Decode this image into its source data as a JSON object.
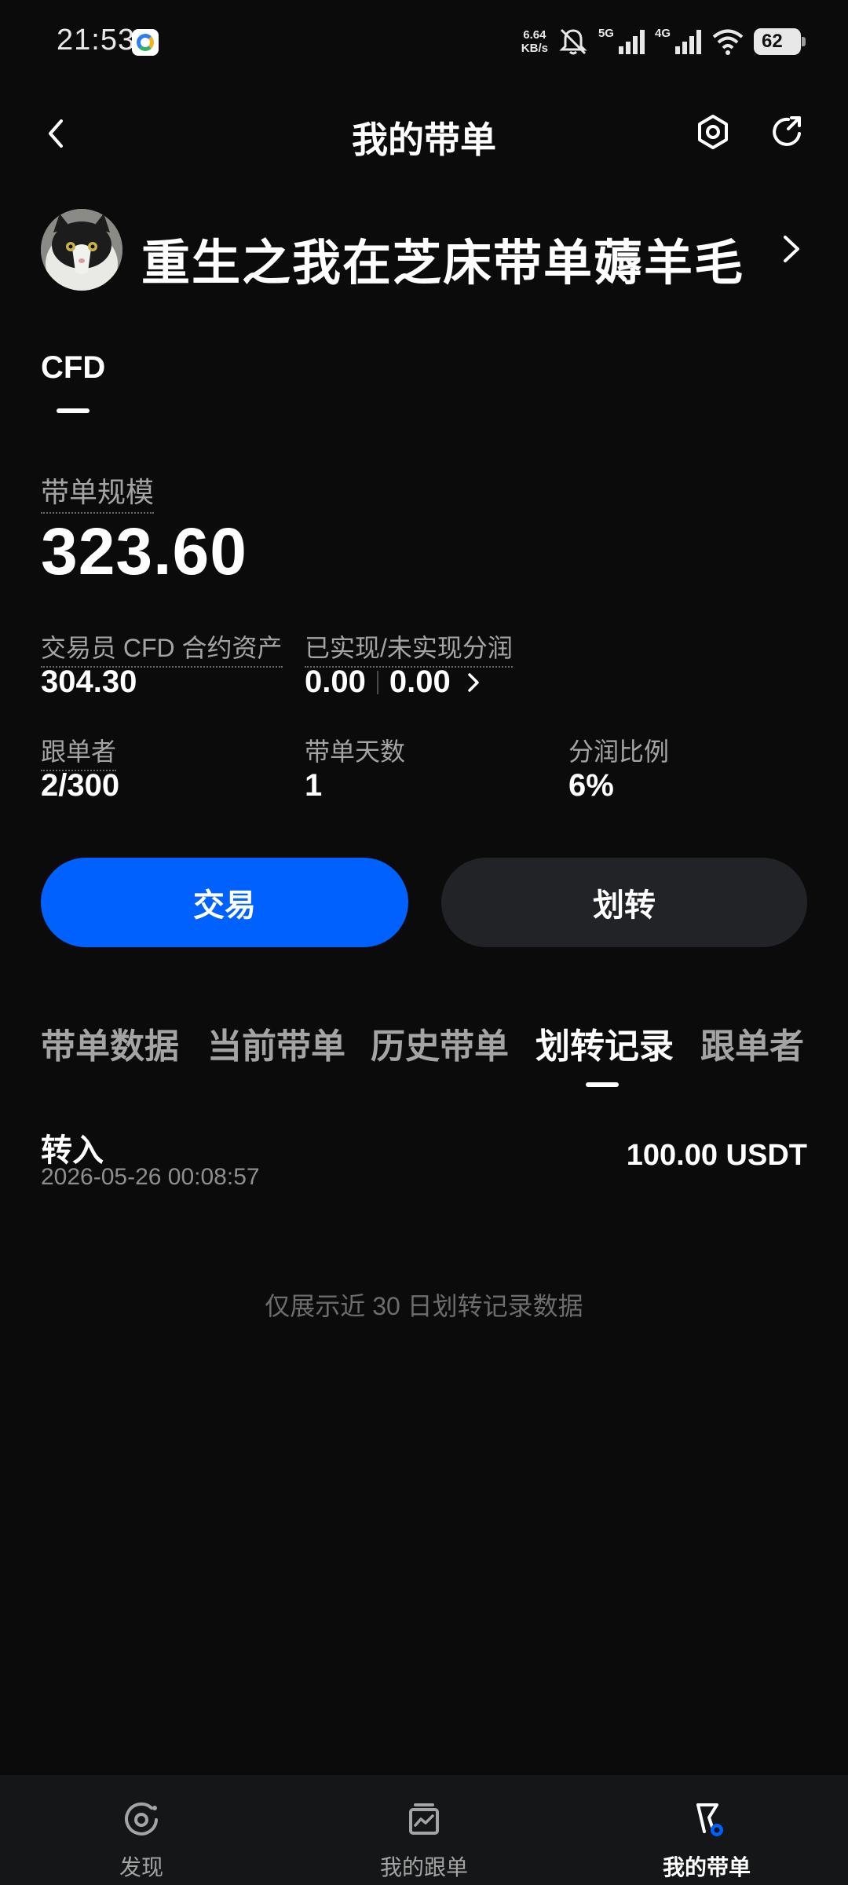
{
  "status_bar": {
    "time": "21:53",
    "net_speed_value": "6.64",
    "net_speed_unit": "KB/s",
    "sim1_label": "5G",
    "sim2_label": "4G",
    "battery_level": "62"
  },
  "header": {
    "title": "我的带单",
    "icons": [
      "back-icon",
      "settings-icon",
      "share-icon"
    ]
  },
  "profile": {
    "name": "重生之我在芝床带单薅羊毛"
  },
  "product_tab": {
    "label": "CFD"
  },
  "scale": {
    "label": "带单规模",
    "value": "323.60"
  },
  "stats": {
    "assets_label": "交易员 CFD 合约资产",
    "assets_value": "304.30",
    "pnl_label": "已实现/未实现分润",
    "realized_value": "0.00",
    "unrealized_value": "0.00",
    "followers_label": "跟单者",
    "followers_value": "2/300",
    "days_label": "带单天数",
    "days_value": "1",
    "share_ratio_label": "分润比例",
    "share_ratio_value": "6%"
  },
  "actions": {
    "trade_label": "交易",
    "transfer_label": "划转"
  },
  "section_tabs": {
    "items": [
      "带单数据",
      "当前带单",
      "历史带单",
      "划转记录",
      "跟单者"
    ],
    "active_index": 3
  },
  "records": [
    {
      "type": "转入",
      "time": "2026-05-26 00:08:57",
      "amount": "100.00 USDT"
    }
  ],
  "notice": "仅展示近 30 日划转记录数据",
  "bottom_nav": {
    "items": [
      "发现",
      "我的跟单",
      "我的带单"
    ],
    "active_index": 2
  },
  "colors": {
    "background": "#0b0b0c",
    "accent": "#0061ff",
    "secondary_button": "#222326",
    "muted_text": "#a4a4a4"
  }
}
